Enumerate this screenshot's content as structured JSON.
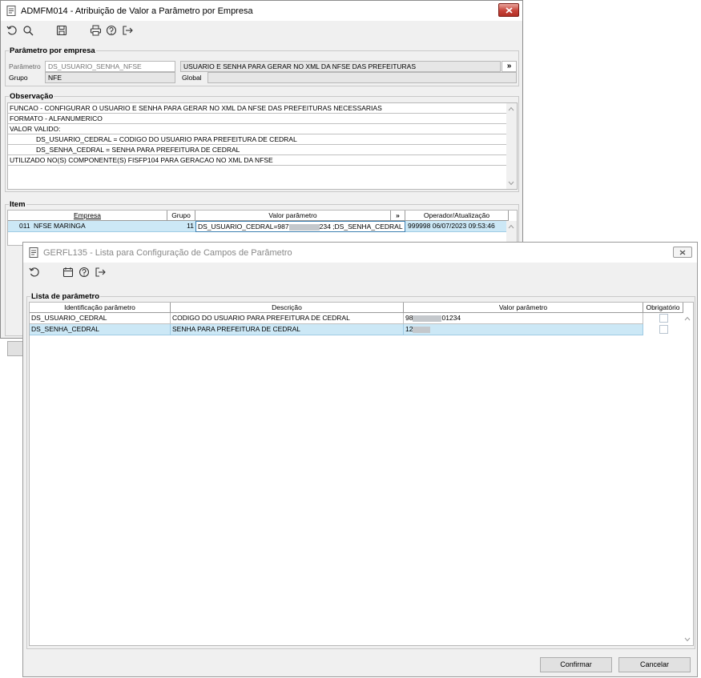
{
  "main_window": {
    "title": "ADMFM014 - Atribuição de Valor a Parâmetro por Empresa",
    "groups": {
      "parametro": {
        "legend": "Parâmetro por empresa",
        "param_label": "Parâmetro",
        "param_value": "DS_USUARIO_SENHA_NFSE",
        "param_desc": "USUARIO E SENHA PARA GERAR NO XML DA NFSE DAS PREFEITURAS",
        "expand_btn": "»",
        "grupo_label": "Grupo",
        "grupo_value": "NFE",
        "global_label": "Global"
      },
      "observacao": {
        "legend": "Observação",
        "lines": [
          "FUNCAO - CONFIGURAR O USUARIO E SENHA PARA GERAR NO XML DA NFSE DAS PREFEITURAS NECESSARIAS",
          "FORMATO - ALFANUMERICO",
          "VALOR VALIDO:",
          "DS_USUARIO_CEDRAL = CODIGO DO USUARIO PARA PREFEITURA DE CEDRAL",
          "DS_SENHA_CEDRAL = SENHA PARA PREFEITURA DE CEDRAL",
          "UTILIZADO NO(S) COMPONENTE(S) FISFP104  PARA GERACAO NO XML DA NFSE"
        ]
      },
      "item": {
        "legend": "Item",
        "columns": {
          "empresa": "Empresa",
          "grupo": "Grupo",
          "valor": "Valor parâmetro",
          "expand": "»",
          "operador": "Operador/Atualização"
        },
        "row": {
          "empresa_code": "011",
          "empresa_name": "NFSE MARINGA",
          "grupo": "11",
          "valor_prefix": "DS_USUARIO_CEDRAL=987",
          "valor_suffix": "234 ;DS_SENHA_CEDRAL",
          "operador": "999998 06/07/2023 09:53:46"
        }
      }
    }
  },
  "dialog": {
    "title": "GERFL135 - Lista para Configuração de Campos de Parâmetro",
    "legend": "Lista de parâmetro",
    "columns": {
      "id": "Identificação parâmetro",
      "desc": "Descrição",
      "valor": "Valor parâmetro",
      "obrig": "Obrigatório"
    },
    "rows": [
      {
        "id": "DS_USUARIO_CEDRAL",
        "desc": "CODIGO DO USUARIO PARA PREFEITURA DE CEDRAL",
        "valor_prefix": "98",
        "valor_suffix": "01234",
        "obrigatorio": false
      },
      {
        "id": "DS_SENHA_CEDRAL",
        "desc": "SENHA PARA PREFEITURA DE CEDRAL",
        "valor_prefix": "12",
        "valor_suffix": "",
        "obrigatorio": false
      }
    ],
    "buttons": {
      "confirm": "Confirmar",
      "cancel": "Cancelar"
    }
  },
  "colors": {
    "selected_row": "#cce8f6",
    "close_red": "#c7443a"
  }
}
